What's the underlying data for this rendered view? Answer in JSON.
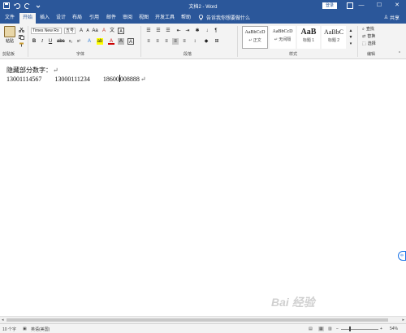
{
  "titlebar": {
    "title": "文档2 - Word",
    "login": "登录",
    "win_min": "—",
    "win_max": "☐",
    "win_close": "✕"
  },
  "tabs": [
    {
      "label": "文件",
      "active": false
    },
    {
      "label": "开始",
      "active": true
    },
    {
      "label": "插入",
      "active": false
    },
    {
      "label": "设计",
      "active": false
    },
    {
      "label": "布局",
      "active": false
    },
    {
      "label": "引用",
      "active": false
    },
    {
      "label": "邮件",
      "active": false
    },
    {
      "label": "审阅",
      "active": false
    },
    {
      "label": "视图",
      "active": false
    },
    {
      "label": "开发工具",
      "active": false
    },
    {
      "label": "帮助",
      "active": false
    }
  ],
  "tell_me": "告诉我你想要做什么",
  "share": "共享",
  "ribbon": {
    "paste_label": "粘贴",
    "clipboard_label": "剪贴板",
    "font_name": "Times New Ro",
    "font_size": "五号",
    "font_label": "字体",
    "paragraph_label": "段落",
    "styles_label": "样式",
    "editing_label": "编辑",
    "styles": [
      {
        "preview": "AaBbCcD",
        "name": "↵ 正文",
        "selected": true
      },
      {
        "preview": "AaBbCcD",
        "name": "↵ 无间隔",
        "selected": false
      },
      {
        "preview": "AaB",
        "name": "标题 1",
        "selected": false
      },
      {
        "preview": "AaBbC",
        "name": "标题 2",
        "selected": false
      }
    ],
    "find": "查找",
    "replace": "替换",
    "select": "选择"
  },
  "document": {
    "heading": "隐藏部分数字：",
    "para_mark": "↵",
    "num1": "13001114567",
    "num2": "13000111234",
    "num3_before_cursor": "18600",
    "num3_after_cursor": "008888"
  },
  "statusbar": {
    "word_count": "10 个字",
    "language": "英语(美国)",
    "zoom": "54%"
  },
  "watermark": "Bai 经验",
  "right_badge": "中"
}
